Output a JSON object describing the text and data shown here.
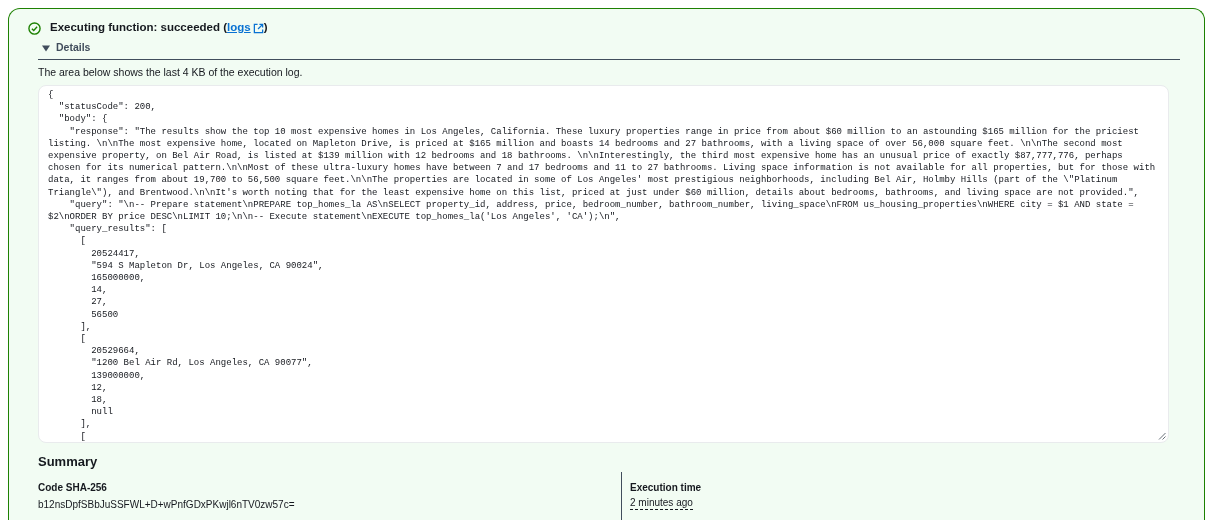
{
  "status": {
    "text_before": "Executing function: succeeded (",
    "link": "logs",
    "text_after": ")"
  },
  "details": {
    "label": "Details",
    "expanded": true,
    "description": "The area below shows the last 4 KB of the execution log.",
    "log_lines": [
      "{",
      "  \"statusCode\": 200,",
      "  \"body\": {",
      "    \"response\": \"The results show the top 10 most expensive homes in Los Angeles, California. These luxury properties range in price from about $60 million to an astounding $165 million for the priciest",
      "listing. \\n\\nThe most expensive home, located on Mapleton Drive, is priced at $165 million and boasts 14 bedrooms and 27 bathrooms, with a living space of over 56,000 square feet. \\n\\nThe second most",
      "expensive property, on Bel Air Road, is listed at $139 million with 12 bedrooms and 18 bathrooms. \\n\\nInterestingly, the third most expensive home has an unusual price of exactly $87,777,776, perhaps",
      "chosen for its numerical pattern.\\n\\nMost of these ultra-luxury homes have between 7 and 17 bedrooms and 11 to 27 bathrooms. Living space information is not available for all properties, but for those with",
      "data, it ranges from about 19,700 to 56,500 square feet.\\n\\nThe properties are located in some of Los Angeles' most prestigious neighborhoods, including Bel Air, Holmby Hills (part of the \\\"Platinum",
      "Triangle\\\"), and Brentwood.\\n\\nIt's worth noting that for the least expensive home on this list, priced at just under $60 million, details about bedrooms, bathrooms, and living space are not provided.\",",
      "    \"query\": \"\\n-- Prepare statement\\nPREPARE top_homes_la AS\\nSELECT property_id, address, price, bedroom_number, bathroom_number, living_space\\nFROM us_housing_properties\\nWHERE city = $1 AND state =",
      "$2\\nORDER BY price DESC\\nLIMIT 10;\\n\\n-- Execute statement\\nEXECUTE top_homes_la('Los Angeles', 'CA');\\n\",",
      "    \"query_results\": [",
      "      [",
      "        20524417,",
      "        \"594 S Mapleton Dr, Los Angeles, CA 90024\",",
      "        165000000,",
      "        14,",
      "        27,",
      "        56500",
      "      ],",
      "      [",
      "        20529664,",
      "        \"1200 Bel Air Rd, Los Angeles, CA 90077\",",
      "        139000000,",
      "        12,",
      "        18,",
      "        null",
      "      ],",
      "      ["
    ]
  },
  "summary": {
    "title": "Summary",
    "items": [
      {
        "label": "Code SHA-256",
        "value": "b12nsDpfSBbJuSSFWL+D+wPnfGDxPKwjl6nTV0zw57c=",
        "kind": "plain"
      },
      {
        "label": "Execution time",
        "value": "2 minutes ago",
        "kind": "relative_time"
      }
    ]
  }
}
